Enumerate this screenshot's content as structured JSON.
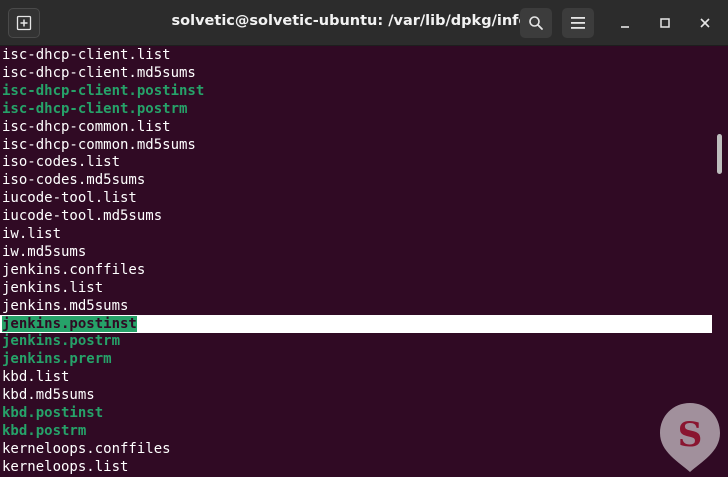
{
  "window": {
    "title": "solvetic@solvetic-ubuntu: /var/lib/dpkg/info"
  },
  "titlebar_buttons": {
    "new_tab_icon": "new-tab-icon",
    "search_icon": "search-icon",
    "menu_icon": "hamburger-menu-icon",
    "minimize_icon": "minimize-icon",
    "maximize_icon": "maximize-icon",
    "close_icon": "close-icon"
  },
  "terminal": {
    "lines": [
      {
        "text": "isc-dhcp-client.list",
        "style": "normal"
      },
      {
        "text": "isc-dhcp-client.md5sums",
        "style": "normal"
      },
      {
        "text": "isc-dhcp-client.postinst",
        "style": "green"
      },
      {
        "text": "isc-dhcp-client.postrm",
        "style": "green"
      },
      {
        "text": "isc-dhcp-common.list",
        "style": "normal"
      },
      {
        "text": "isc-dhcp-common.md5sums",
        "style": "normal"
      },
      {
        "text": "iso-codes.list",
        "style": "normal"
      },
      {
        "text": "iso-codes.md5sums",
        "style": "normal"
      },
      {
        "text": "iucode-tool.list",
        "style": "normal"
      },
      {
        "text": "iucode-tool.md5sums",
        "style": "normal"
      },
      {
        "text": "iw.list",
        "style": "normal"
      },
      {
        "text": "iw.md5sums",
        "style": "normal"
      },
      {
        "text": "jenkins.conffiles",
        "style": "normal"
      },
      {
        "text": "jenkins.list",
        "style": "normal"
      },
      {
        "text": "jenkins.md5sums",
        "style": "normal"
      },
      {
        "text": "jenkins.postinst",
        "style": "selected"
      },
      {
        "text": "jenkins.postrm",
        "style": "green"
      },
      {
        "text": "jenkins.prerm",
        "style": "green"
      },
      {
        "text": "kbd.list",
        "style": "normal"
      },
      {
        "text": "kbd.md5sums",
        "style": "normal"
      },
      {
        "text": "kbd.postinst",
        "style": "green"
      },
      {
        "text": "kbd.postrm",
        "style": "green"
      },
      {
        "text": "kerneloops.conffiles",
        "style": "normal"
      },
      {
        "text": "kerneloops.list",
        "style": "normal"
      }
    ]
  },
  "colors": {
    "terminal_bg": "#300a24",
    "titlebar_bg": "#2c2c2c",
    "executable_green": "#26a269",
    "text": "#ffffff",
    "selection_bg": "#ffffff"
  },
  "watermark": {
    "icon": "solvetic-logo-icon"
  }
}
